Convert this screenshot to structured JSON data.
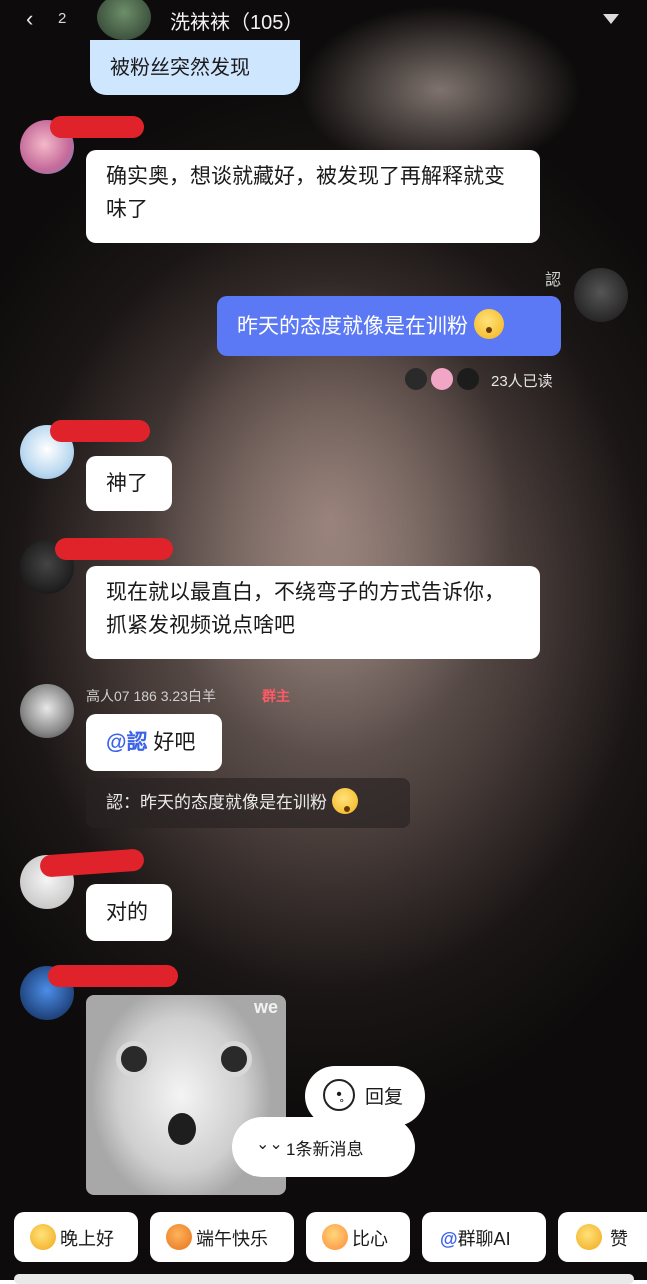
{
  "header": {
    "back_count": "2",
    "group_title": "洗袜袜（105）"
  },
  "messages": {
    "top_partial": "被粉丝突然发现",
    "msg1": "确实奥，想谈就藏好，被发现了再解释就变味了",
    "me_name": "認",
    "msg2": "昨天的态度就像是在训粉",
    "read_receipt": "23人已读",
    "msg3": "神了",
    "msg4": "现在就以最直白，不绕弯子的方式告诉你，抓紧发视频说点啥吧",
    "sender5_name": "高人07 186 3.23白羊",
    "sender5_badge": "群主",
    "msg5_mention": "@認",
    "msg5_text": " 好吧",
    "quote": "認：昨天的态度就像是在训粉",
    "msg6": "对的",
    "image_watermark": "we"
  },
  "popups": {
    "reply_label": "回复",
    "new_message_label": "1条新消息"
  },
  "quick_replies": [
    {
      "label": "晚上好",
      "icon": "star-face-emoji"
    },
    {
      "label": "端午快乐",
      "icon": "tiger-face-emoji"
    },
    {
      "label": "比心",
      "icon": "heart-hands-emoji"
    },
    {
      "label": "群聊AI",
      "prefix": "@",
      "icon": "at-symbol"
    },
    {
      "label": "赞",
      "icon": "thumbs-up-emoji"
    }
  ],
  "colors": {
    "my_bubble": "#5b78f5",
    "owner_badge": "#ff5a64",
    "redaction": "#e0232b"
  }
}
